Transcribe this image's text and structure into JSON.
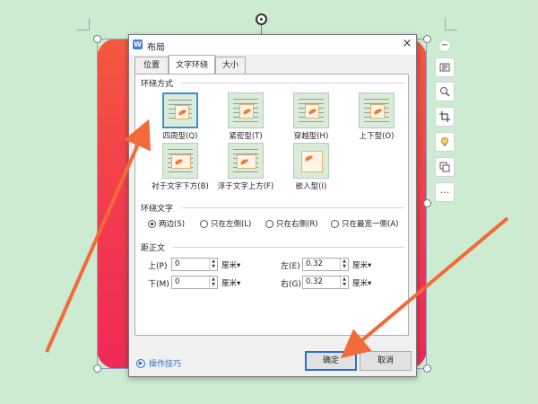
{
  "dialog": {
    "title": "布局",
    "app_icon_text": "W",
    "close_glyph": "×",
    "tabs": [
      {
        "label": "位置"
      },
      {
        "label": "文字环绕",
        "active": true
      },
      {
        "label": "大小"
      }
    ],
    "wrap_section": {
      "heading": "环绕方式",
      "options": [
        {
          "label": "四周型(Q)",
          "selected": true
        },
        {
          "label": "紧密型(T)"
        },
        {
          "label": "穿越型(H)"
        },
        {
          "label": "上下型(O)"
        },
        {
          "label": "衬于文字下方(B)"
        },
        {
          "label": "浮于文字上方(F)"
        },
        {
          "label": "嵌入型(I)"
        }
      ]
    },
    "text_section": {
      "heading": "环绕文字",
      "options": [
        {
          "label": "两边(S)",
          "selected": true
        },
        {
          "label": "只在左侧(L)"
        },
        {
          "label": "只在右侧(R)"
        },
        {
          "label": "只在最宽一侧(A)"
        }
      ]
    },
    "distance_section": {
      "heading": "距正文",
      "top": {
        "label": "上(P)",
        "value": "0",
        "unit": "厘米▾"
      },
      "bottom": {
        "label": "下(M)",
        "value": "0",
        "unit": "厘米▾"
      },
      "left": {
        "label": "左(E)",
        "value": "0.32",
        "unit": "厘米▾"
      },
      "right": {
        "label": "右(G)",
        "value": "0.32",
        "unit": "厘米▾"
      }
    },
    "tips_label": "操作技巧",
    "ok_label": "确定",
    "cancel_label": "取消"
  },
  "sidebar": {
    "icons": [
      "minus-icon",
      "layout-icon",
      "zoom-icon",
      "crop-icon",
      "lightbulb-icon",
      "image-convert-icon",
      "more-icon"
    ],
    "more_glyph": "···",
    "minus_glyph": "−"
  },
  "colors": {
    "background": "#cfe6cf",
    "picture_top": "#f4573f",
    "picture_bottom": "#ee2b55",
    "arrow": "#f26a3a",
    "accent": "#2a6ed6"
  }
}
